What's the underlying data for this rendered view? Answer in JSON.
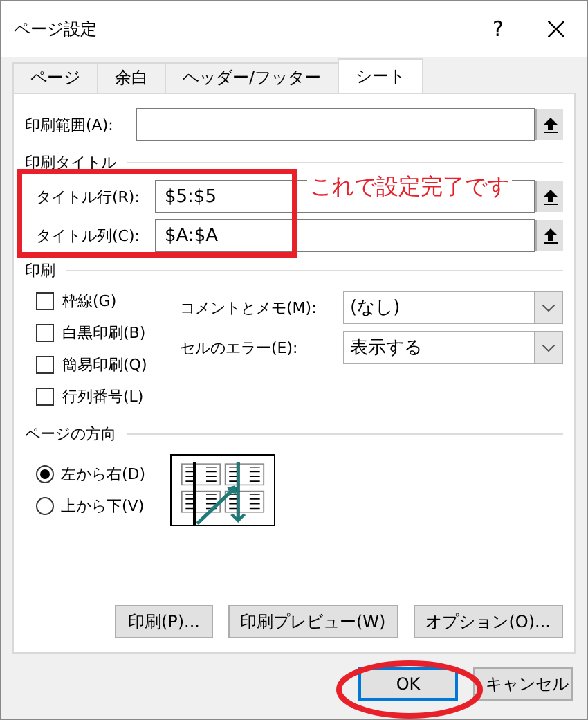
{
  "window": {
    "title": "ページ設定",
    "help": "?"
  },
  "tabs": [
    {
      "label": "ページ",
      "selected": false
    },
    {
      "label": "余白",
      "selected": false
    },
    {
      "label": "ヘッダー/フッター",
      "selected": false
    },
    {
      "label": "シート",
      "selected": true
    }
  ],
  "print_area": {
    "label": "印刷範囲(A):"
  },
  "print_titles": {
    "heading": "印刷タイトル",
    "highlighted": true,
    "rows": [
      {
        "label": "タイトル行(R):",
        "value": "$5:$5"
      },
      {
        "label": "タイトル列(C):",
        "value": "$A:$A"
      }
    ]
  },
  "annotation": "これで設定完了です",
  "print": {
    "heading": "印刷",
    "checkboxes": [
      {
        "label": "枠線(G)",
        "checked": false
      },
      {
        "label": "白黒印刷(B)",
        "checked": false
      },
      {
        "label": "簡易印刷(Q)",
        "checked": false
      },
      {
        "label": "行列番号(L)",
        "checked": false
      }
    ],
    "selects": [
      {
        "label": "コメントとメモ(M):",
        "value": "(なし)"
      },
      {
        "label": "セルのエラー(E):",
        "value": "表示する"
      }
    ]
  },
  "page_order": {
    "heading": "ページの方向",
    "options": [
      {
        "label": "左から右(D)",
        "selected": true
      },
      {
        "label": "上から下(V)",
        "selected": false
      }
    ]
  },
  "buttons": [
    "印刷(P)...",
    "印刷プレビュー(W)",
    "オプション(O)..."
  ],
  "footer_buttons": [
    {
      "label": "OK",
      "default": true,
      "circled": true
    },
    {
      "label": "キャンセル",
      "default": false,
      "circled": false
    }
  ]
}
